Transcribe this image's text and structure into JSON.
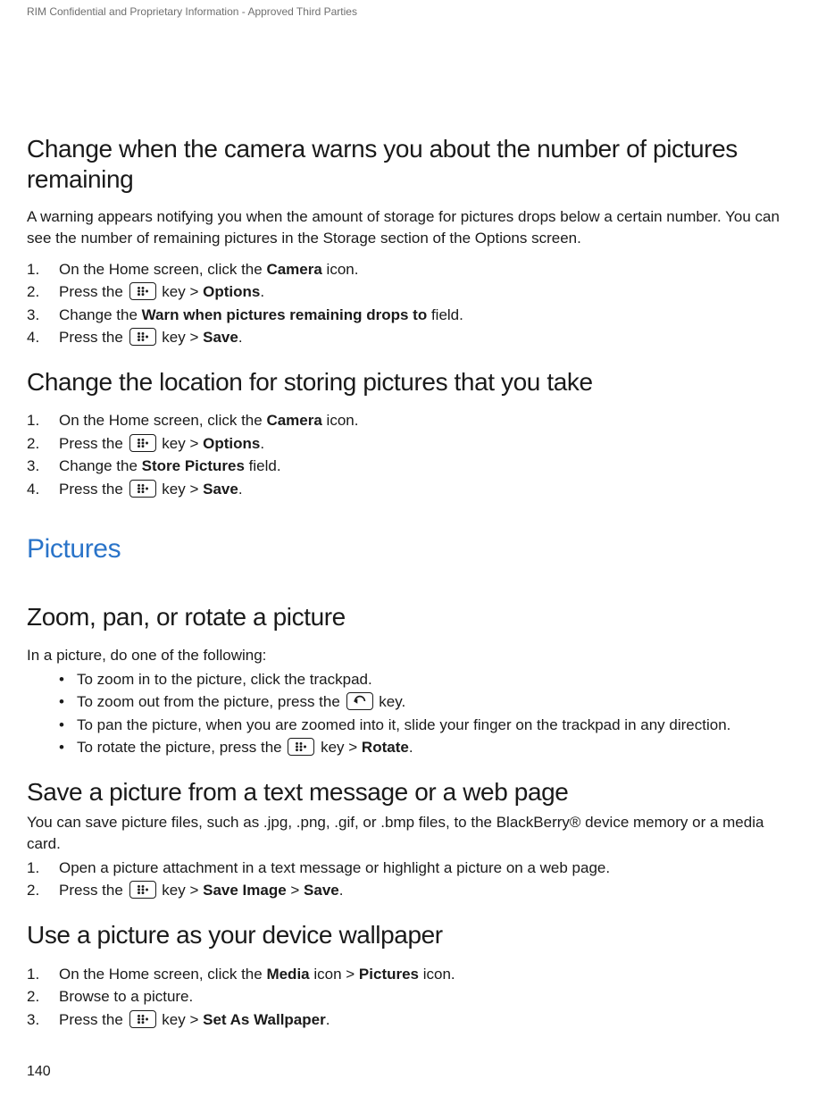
{
  "header": {
    "confidential": "RIM Confidential and Proprietary Information - Approved Third Parties"
  },
  "page_number": "140",
  "sections": [
    {
      "heading": "Change when the camera warns you about the number of pictures remaining",
      "intro": "A warning appears notifying you when the amount of storage for pictures drops below a certain number. You can see the number of remaining pictures in the Storage section of the Options screen.",
      "step1": {
        "a": "On the Home screen, click the ",
        "b": "Camera",
        "c": " icon."
      },
      "step2": {
        "a": "Press the ",
        "b": " key > ",
        "c": "Options",
        "d": "."
      },
      "step3": {
        "a": "Change the ",
        "b": "Warn when pictures remaining drops to",
        "c": " field."
      },
      "step4": {
        "a": "Press the ",
        "b": " key > ",
        "c": "Save",
        "d": "."
      }
    },
    {
      "heading": "Change the location for storing pictures that you take",
      "step1": {
        "a": "On the Home screen, click the ",
        "b": "Camera",
        "c": " icon."
      },
      "step2": {
        "a": "Press the ",
        "b": " key > ",
        "c": "Options",
        "d": "."
      },
      "step3": {
        "a": "Change the ",
        "b": "Store Pictures",
        "c": " field."
      },
      "step4": {
        "a": "Press the ",
        "b": " key > ",
        "c": "Save",
        "d": "."
      }
    }
  ],
  "pictures_title": "Pictures",
  "zoom": {
    "heading": "Zoom, pan, or rotate a picture",
    "intro": "In a picture, do one of the following:",
    "b1": "To zoom in to the picture, click the trackpad.",
    "b2": {
      "a": "To zoom out from the picture, press the ",
      "b": " key."
    },
    "b3": "To pan the picture, when you are zoomed into it, slide your finger on the trackpad in any direction.",
    "b4": {
      "a": "To rotate the picture, press the ",
      "b": " key > ",
      "c": "Rotate",
      "d": "."
    }
  },
  "save_pic": {
    "heading": "Save a picture from a text message or a web page",
    "intro": "You can save picture files, such as .jpg, .png, .gif, or .bmp files, to the BlackBerry® device memory or a media card.",
    "step1": "Open a picture attachment in a text message or highlight a picture on a web page.",
    "step2": {
      "a": "Press the ",
      "b": " key > ",
      "c": "Save Image",
      "d": " > ",
      "e": "Save",
      "f": "."
    }
  },
  "wallpaper": {
    "heading": "Use a picture as your device wallpaper",
    "step1": {
      "a": "On the Home screen, click the ",
      "b": "Media",
      "c": " icon > ",
      "d": "Pictures",
      "e": " icon."
    },
    "step2": "Browse to a picture.",
    "step3": {
      "a": "Press the ",
      "b": " key > ",
      "c": "Set As Wallpaper",
      "d": "."
    }
  }
}
